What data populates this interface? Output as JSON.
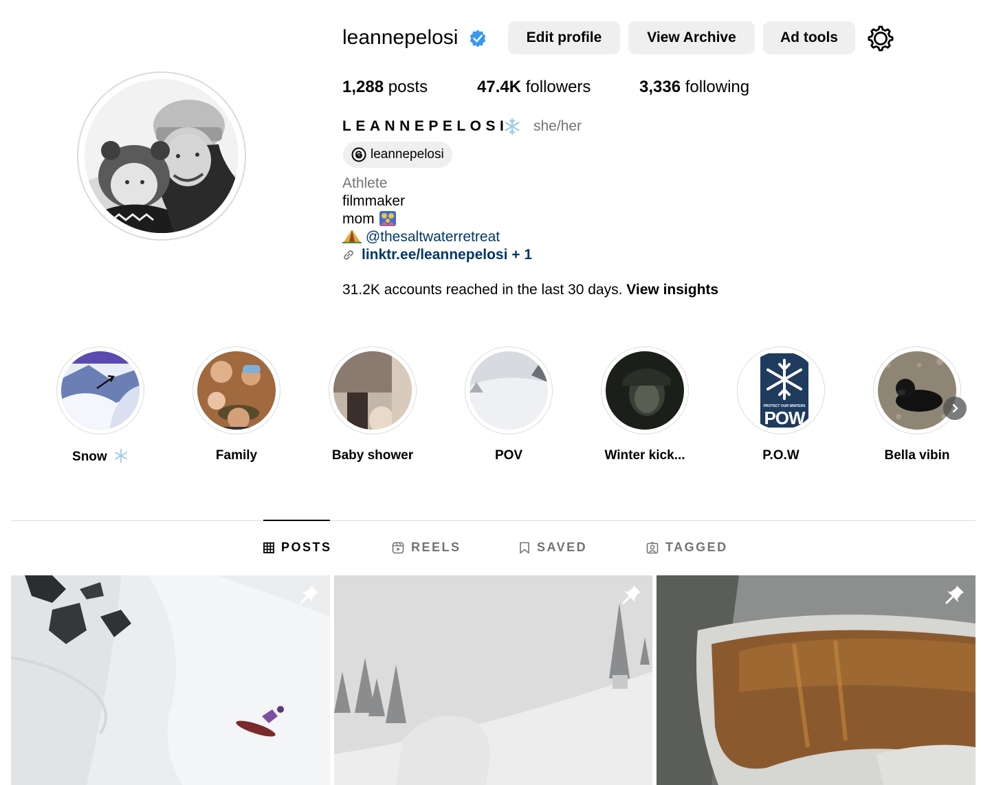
{
  "profile": {
    "username": "leannepelosi",
    "buttons": {
      "edit": "Edit profile",
      "archive": "View Archive",
      "ad_tools": "Ad tools"
    },
    "stats": {
      "posts_count": "1,288",
      "posts_label": " posts",
      "followers_count": "47.4K",
      "followers_label": " followers",
      "following_count": "3,336",
      "following_label": " following"
    },
    "full_name": "LEANNEPELOSI",
    "pronouns": "she/her",
    "threads_handle": "leannepelosi",
    "bio": {
      "category": "Athlete",
      "line1": "filmmaker",
      "line2": "mom",
      "mention": "@thesaltwaterretreat",
      "link": "linktr.ee/leannepelosi + 1"
    },
    "insights": {
      "text": "31.2K accounts reached in the last 30 days. ",
      "link": "View insights"
    }
  },
  "highlights": [
    {
      "label": "Snow"
    },
    {
      "label": "Family"
    },
    {
      "label": "Baby shower"
    },
    {
      "label": "POV"
    },
    {
      "label": "Winter kick..."
    },
    {
      "label": "P.O.W"
    },
    {
      "label": "Bella vibin"
    }
  ],
  "highlight_pow_logo": {
    "small_text": "PROTECT OUR WINTERS",
    "big_text": "POW"
  },
  "tabs": [
    {
      "label": "POSTS"
    },
    {
      "label": "REELS"
    },
    {
      "label": "SAVED"
    },
    {
      "label": "TAGGED"
    }
  ],
  "icons": [
    "verified-badge-icon",
    "settings-gear-icon",
    "threads-icon",
    "link-icon",
    "camping-tent-emoji",
    "family-emoji",
    "snowflake-emoji",
    "grid-icon",
    "reels-icon",
    "bookmark-icon",
    "tagged-icon",
    "pin-icon",
    "chevron-right-icon"
  ],
  "colors": {
    "accent_link": "#00376b",
    "verified": "#3897f0",
    "button_bg": "#efefef",
    "muted": "#737373",
    "pow_navy": "#1f3b5e"
  }
}
